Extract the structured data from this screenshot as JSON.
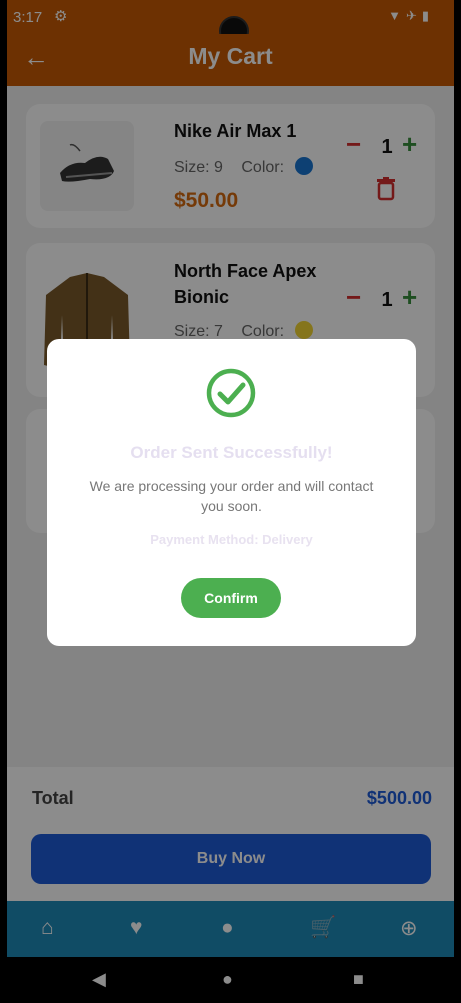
{
  "status": {
    "time": "3:17"
  },
  "appbar": {
    "title": "My Cart"
  },
  "cart": {
    "items": [
      {
        "name": "Nike Air Max 1",
        "size_label": "Size: 9",
        "color_label": "Color:",
        "color": "#1976d2",
        "price": "$50.00",
        "qty": "1"
      },
      {
        "name": "North Face Apex Bionic",
        "size_label": "Size: 7",
        "color_label": "Color:",
        "color": "#f2d633",
        "qty": "1"
      }
    ]
  },
  "summary": {
    "total_label": "Total",
    "total_value": "$500.00",
    "buy_label": "Buy Now"
  },
  "colors": {
    "primary": "#c65a05",
    "accent_blue": "#1e5bd8",
    "success": "#4caf50",
    "danger": "#d32f2f",
    "nav": "#1e8ab8"
  },
  "dialog": {
    "title": "Order Sent Successfully!",
    "message": "We are processing your order and will contact you soon.",
    "payment": "Payment Method: Delivery",
    "confirm_label": "Confirm"
  },
  "icons": {
    "back": "arrow-left-icon",
    "minus": "minus-icon",
    "plus": "plus-icon",
    "delete": "trash-icon",
    "home": "home-icon",
    "favorites": "heart-icon",
    "profile": "person-icon",
    "cart": "cart-icon",
    "add_cart": "cart-plus-icon",
    "check": "check-circle-icon"
  }
}
